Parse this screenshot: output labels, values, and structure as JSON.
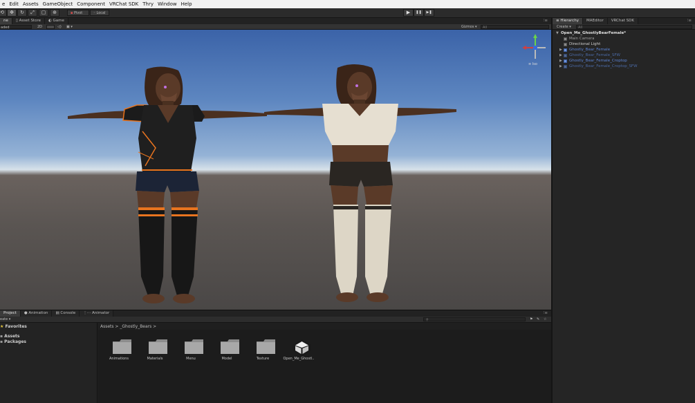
{
  "menu": [
    "e",
    "Edit",
    "Assets",
    "GameObject",
    "Component",
    "VRChat SDK",
    "Thry",
    "Window",
    "Help"
  ],
  "toolbar": {
    "tools": [
      "⟲",
      "✥",
      "↻",
      "⤢",
      "▢",
      "⊕"
    ],
    "pivot_label": "Pivot",
    "local_label": "Local",
    "play_icon": "▶",
    "pause_icon": "❚❚",
    "step_icon": "▶❚"
  },
  "scene_tabs": [
    "ne",
    "Asset Store",
    "Game"
  ],
  "scene_sub": {
    "shaded": "aded",
    "mode_2d": "2D",
    "gizmos": "Gizmos",
    "search_placeholder": "All"
  },
  "gizmo_label": "≡ Iso",
  "hierarchy": {
    "tabs": [
      "Hierarchy",
      "MAEditor",
      "VRChat SDK"
    ],
    "create_label": "Create",
    "search_placeholder": "All",
    "scene": "Open_Me_GhostlyBearFemale*",
    "items": [
      {
        "label": "Main Camera",
        "type": "go",
        "arrow": ""
      },
      {
        "label": "Directional Light",
        "type": "go",
        "arrow": ""
      },
      {
        "label": "Ghostly_Bear_Female",
        "type": "prefab",
        "arrow": "▶"
      },
      {
        "label": "Ghostly_Bear_Female_SFW",
        "type": "prefab-dim",
        "arrow": "▶"
      },
      {
        "label": "Ghostly_Bear_Female_Croptop",
        "type": "prefab",
        "arrow": "▶"
      },
      {
        "label": "Ghostly_Bear_Female_Croptop_SFW",
        "type": "prefab-dim",
        "arrow": "▶"
      }
    ]
  },
  "project": {
    "tabs": [
      "Project",
      "Animation",
      "Console",
      "Animator"
    ],
    "create_label": "eate",
    "favorites": "Favorites",
    "tree": [
      "Assets",
      "Packages"
    ],
    "breadcrumb": "Assets  >  _Ghostly_Bears  >",
    "assets": [
      {
        "label": "Animations",
        "kind": "folder"
      },
      {
        "label": "Materials",
        "kind": "folder"
      },
      {
        "label": "Menu",
        "kind": "folder"
      },
      {
        "label": "Model",
        "kind": "folder"
      },
      {
        "label": "Texture",
        "kind": "folder"
      },
      {
        "label": "Open_Me_Ghostl..",
        "kind": "scene"
      }
    ]
  },
  "colors": {
    "accent_prefab": "#5c84d6",
    "outfit_orange": "#e8741f",
    "sweater": "#e6dfd1"
  }
}
